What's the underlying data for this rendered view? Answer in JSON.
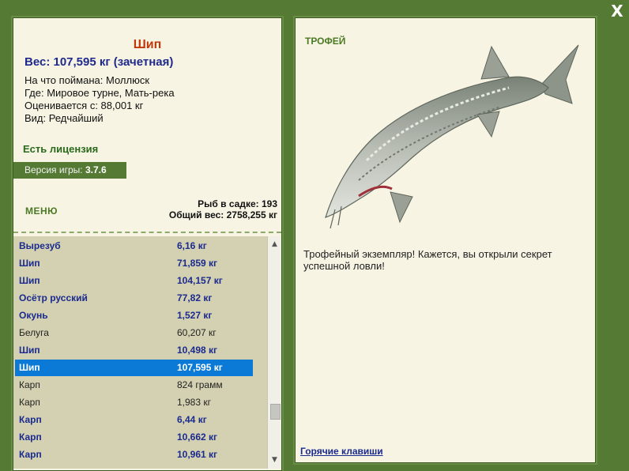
{
  "close_label": "X",
  "fish": {
    "name": "Шип",
    "weight_line": "Вес: 107,595 кг (зачетная)",
    "details": [
      "На что поймана: Моллюск",
      "Где: Мировое турне, Мать-река",
      "Оценивается с: 88,001 кг",
      "Вид: Редчайший"
    ]
  },
  "license": "Есть лицензия",
  "version": {
    "label": "Версия игры: ",
    "value": "3.7.6"
  },
  "menu_label": "МЕНЮ",
  "keepnet": {
    "count_line": "Рыб в садке: 193",
    "total_line": "Общий вес: 2758,255 кг"
  },
  "list": [
    {
      "name": "Вырезуб",
      "weight": "6,16 кг",
      "trophy": true
    },
    {
      "name": "Шип",
      "weight": "71,859 кг",
      "trophy": true
    },
    {
      "name": "Шип",
      "weight": "104,157 кг",
      "trophy": true
    },
    {
      "name": "Осётр русский",
      "weight": "77,82 кг",
      "trophy": true
    },
    {
      "name": "Окунь",
      "weight": "1,527 кг",
      "trophy": true
    },
    {
      "name": "Белуга",
      "weight": "60,207 кг",
      "trophy": false
    },
    {
      "name": "Шип",
      "weight": "10,498 кг",
      "trophy": true
    },
    {
      "name": "Шип",
      "weight": "107,595 кг",
      "trophy": true,
      "selected": true
    },
    {
      "name": "Карп",
      "weight": "824 грамм",
      "trophy": false
    },
    {
      "name": "Карп",
      "weight": "1,983 кг",
      "trophy": false
    },
    {
      "name": "Карп",
      "weight": "6,44 кг",
      "trophy": true
    },
    {
      "name": "Карп",
      "weight": "10,662 кг",
      "trophy": true
    },
    {
      "name": "Карп",
      "weight": "10,961 кг",
      "trophy": true
    }
  ],
  "scroll": {
    "up": "▲",
    "down": "▼"
  },
  "trophy": {
    "title": "ТРОФЕЙ",
    "description": "Трофейный экземпляр! Кажется, вы открыли секрет успешной ловли!"
  },
  "hotkeys_label": "Горячие клавиши",
  "colors": {
    "background": "#557a34",
    "panel": "#f7f4e3",
    "selected_row": "#0a7ad6",
    "trophy_text": "#1a2a8e",
    "fish_name": "#c0390b"
  }
}
